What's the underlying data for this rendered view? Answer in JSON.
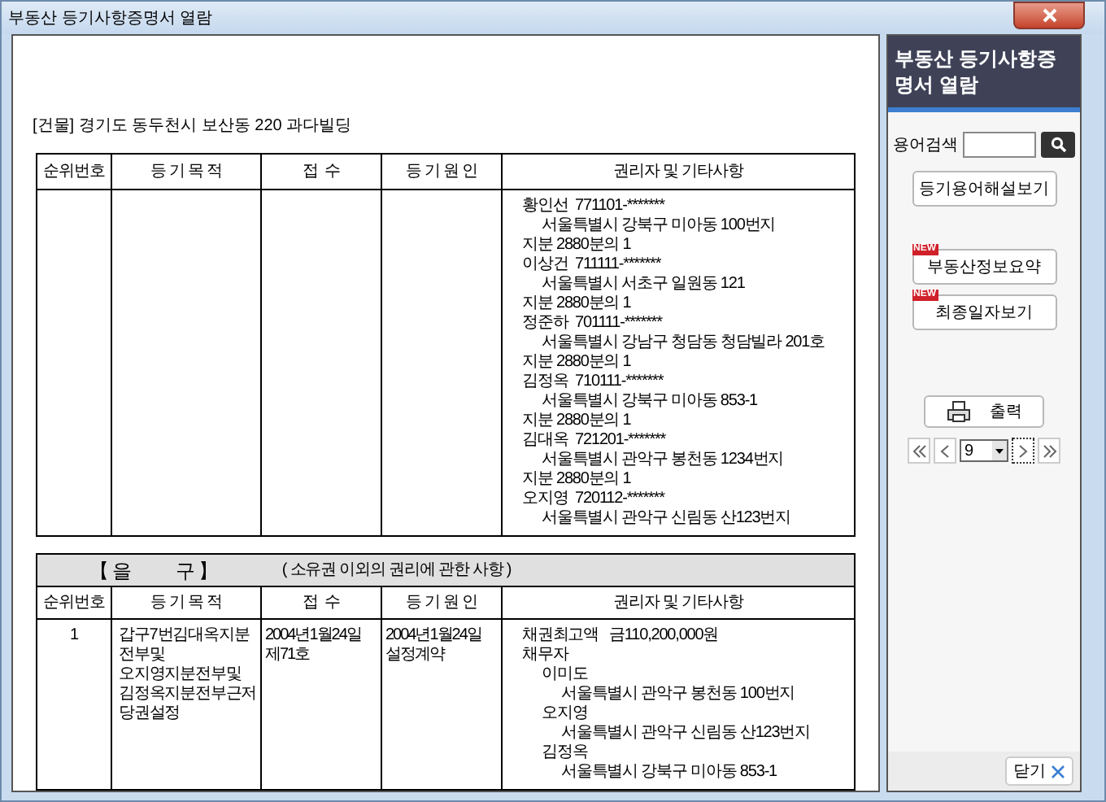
{
  "window": {
    "title": "부동산 등기사항증명서 열람"
  },
  "document": {
    "address": "[건물] 경기도 동두천시 보산동 220 과다빌딩",
    "table1": {
      "columns": [
        "순위번호",
        "등 기 목 적",
        "접  수",
        "등 기 원 인",
        "권리자 및 기타사항"
      ],
      "rows": [
        {
          "rank": "",
          "purpose": [],
          "receipt": [],
          "cause": [],
          "rights": [
            {
              "kind": "holder",
              "text": "황인선  771101-*******"
            },
            {
              "kind": "address",
              "text": "서울특별시 강북구 미아동 100번지"
            },
            {
              "kind": "holder",
              "text": "지분 2880분의 1"
            },
            {
              "kind": "holder",
              "text": "이상건  711111-*******"
            },
            {
              "kind": "address",
              "text": "서울특별시 서초구 일원동 121"
            },
            {
              "kind": "holder",
              "text": "지분 2880분의 1"
            },
            {
              "kind": "holder",
              "text": "정준하  701111-*******"
            },
            {
              "kind": "address",
              "text": "서울특별시 강남구 청담동 청담빌라 201호"
            },
            {
              "kind": "holder",
              "text": "지분 2880분의 1"
            },
            {
              "kind": "holder",
              "text": "김정옥  710111-*******"
            },
            {
              "kind": "address",
              "text": "서울특별시 강북구 미아동 853-1"
            },
            {
              "kind": "holder",
              "text": "지분 2880분의 1"
            },
            {
              "kind": "holder",
              "text": "김대옥  721201-*******"
            },
            {
              "kind": "address",
              "text": "서울특별시 관악구 봉천동 1234번지"
            },
            {
              "kind": "holder",
              "text": "지분 2880분의 1"
            },
            {
              "kind": "holder",
              "text": "오지영  720112-*******"
            },
            {
              "kind": "address",
              "text": "서울특별시 관악구 신림동 산123번지"
            }
          ]
        }
      ]
    },
    "table2": {
      "title": "【 을          구 】",
      "subtitle": "( 소유권 이외의 권리에 관한 사항 )",
      "columns": [
        "순위번호",
        "등 기 목 적",
        "접  수",
        "등 기 원 인",
        "권리자 및 기타사항"
      ],
      "rows": [
        {
          "rank": "1",
          "purpose": [
            "갑구7번김대옥지분",
            "전부및",
            "오지영지분전부및",
            "김정옥지분전부근저",
            "당권설정"
          ],
          "receipt": [
            "2004년1월24일",
            "제71호"
          ],
          "cause": [
            "2004년1월24일",
            "설정계약"
          ],
          "rights": [
            {
              "kind": "holder",
              "text": "채권최고액   금110,200,000원"
            },
            {
              "kind": "holder",
              "text": "채무자"
            },
            {
              "kind": "address",
              "text": "이미도"
            },
            {
              "kind": "subaddress",
              "text": "서울특별시 관악구 봉천동 100번지"
            },
            {
              "kind": "address",
              "text": "오지영"
            },
            {
              "kind": "subaddress",
              "text": "서울특별시 관악구 신림동 산123번지"
            },
            {
              "kind": "address",
              "text": "김정옥"
            },
            {
              "kind": "subaddress",
              "text": "서울특별시 강북구 미아동 853-1"
            }
          ]
        }
      ]
    }
  },
  "panel": {
    "title": "부동산 등기사항증명서 열람",
    "search_label": "용어검색",
    "buttons": [
      {
        "label": "등기용어해설보기"
      },
      {
        "label": "부동산정보요약",
        "badge": "NEW"
      },
      {
        "label": "최종일자보기",
        "badge": "NEW"
      }
    ],
    "print": "출력",
    "page": "9",
    "close": "닫기"
  }
}
